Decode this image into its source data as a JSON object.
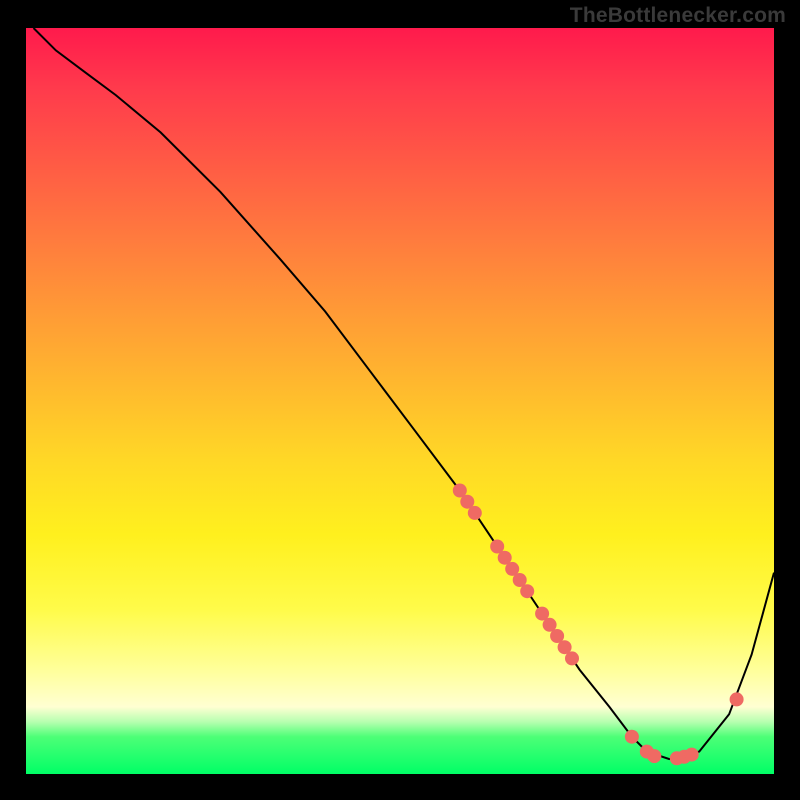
{
  "brand": "TheBottlenecker.com",
  "chart_data": {
    "type": "line",
    "title": "",
    "xlabel": "",
    "ylabel": "",
    "xlim": [
      0,
      100
    ],
    "ylim": [
      0,
      100
    ],
    "curve": {
      "x": [
        1,
        4,
        8,
        12,
        18,
        26,
        34,
        40,
        46,
        52,
        58,
        62,
        66,
        70,
        74,
        78,
        81,
        83,
        86,
        90,
        94,
        97,
        100
      ],
      "y": [
        100,
        97,
        94,
        91,
        86,
        78,
        69,
        62,
        54,
        46,
        38,
        32,
        26,
        20,
        14,
        9,
        5,
        3,
        2,
        3,
        8,
        16,
        27
      ],
      "stroke": "#000000",
      "width": 2
    },
    "markers": {
      "color": "#ef6a63",
      "radius": 7,
      "points": [
        {
          "x": 58,
          "y": 38
        },
        {
          "x": 59,
          "y": 36.5
        },
        {
          "x": 60,
          "y": 35
        },
        {
          "x": 63,
          "y": 30.5
        },
        {
          "x": 64,
          "y": 29
        },
        {
          "x": 65,
          "y": 27.5
        },
        {
          "x": 66,
          "y": 26
        },
        {
          "x": 67,
          "y": 24.5
        },
        {
          "x": 69,
          "y": 21.5
        },
        {
          "x": 70,
          "y": 20
        },
        {
          "x": 71,
          "y": 18.5
        },
        {
          "x": 72,
          "y": 17
        },
        {
          "x": 73,
          "y": 15.5
        },
        {
          "x": 81,
          "y": 5
        },
        {
          "x": 83,
          "y": 3
        },
        {
          "x": 84,
          "y": 2.4
        },
        {
          "x": 87,
          "y": 2.1
        },
        {
          "x": 88,
          "y": 2.3
        },
        {
          "x": 89,
          "y": 2.6
        },
        {
          "x": 95,
          "y": 10
        }
      ]
    }
  }
}
